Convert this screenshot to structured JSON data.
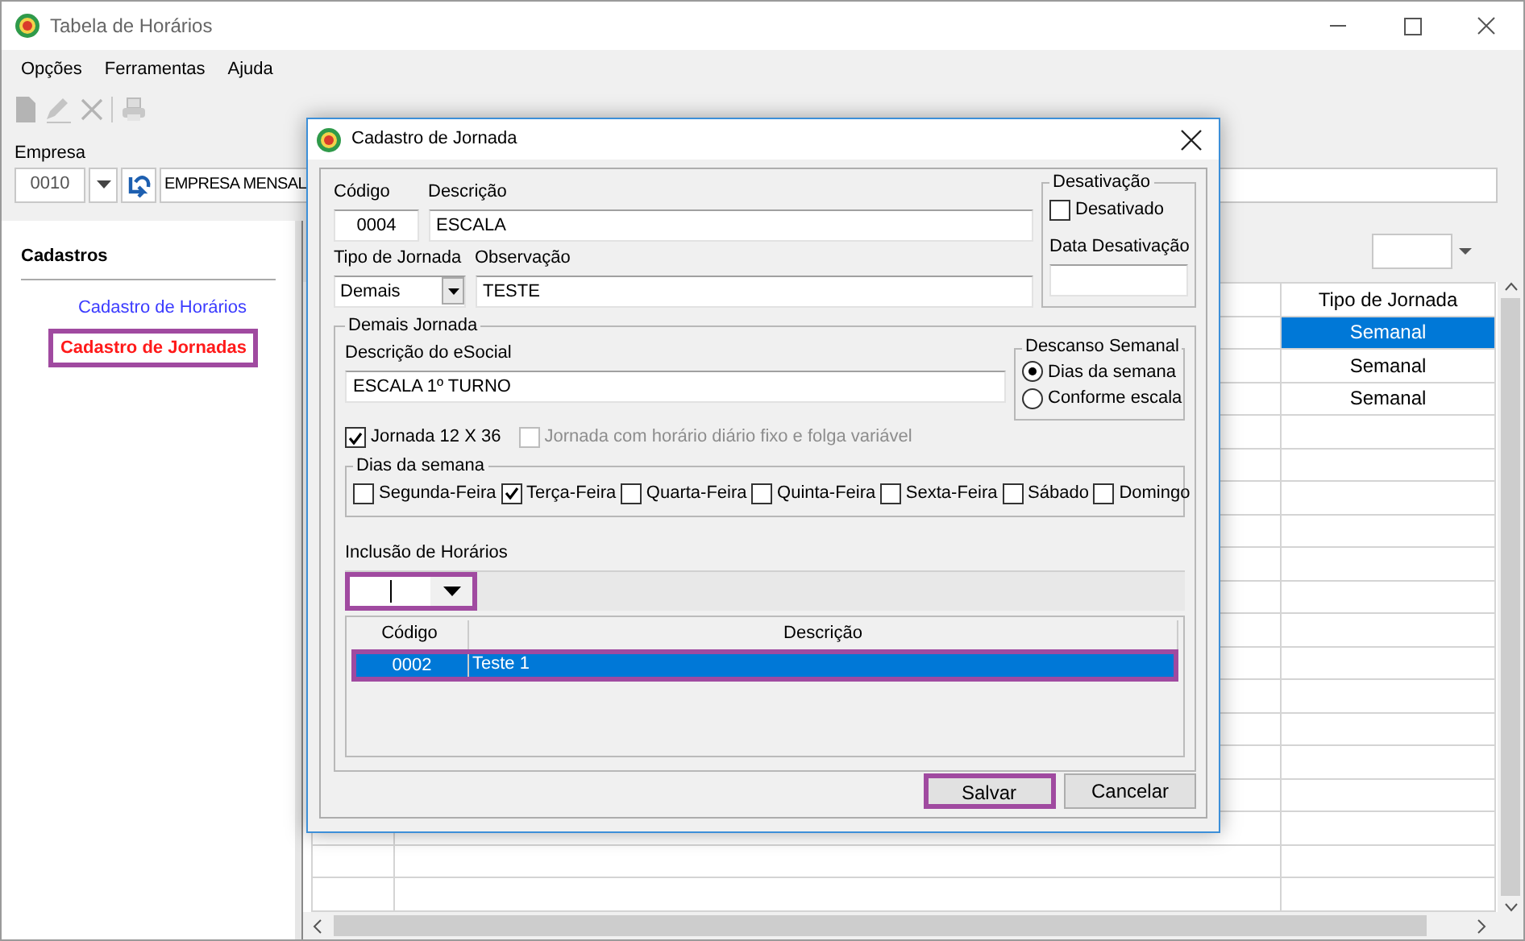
{
  "window": {
    "title": "Tabela de Horários"
  },
  "menu": [
    {
      "label": "Opções"
    },
    {
      "label": "Ferramentas"
    },
    {
      "label": "Ajuda"
    }
  ],
  "empresa": {
    "label": "Empresa",
    "code": "0010",
    "name": "EMPRESA MENSAL"
  },
  "sidebar": {
    "title": "Cadastros",
    "items": [
      {
        "label": "Cadastro de Horários",
        "selected": false,
        "highlighted": false
      },
      {
        "label": "Cadastro de Jornadas",
        "selected": true,
        "highlighted": true
      }
    ]
  },
  "grid": {
    "columns": [
      "Tipo de Jornada"
    ],
    "rows": [
      {
        "tipo_de_jornada": "Semanal",
        "selected": true
      },
      {
        "tipo_de_jornada": "Semanal",
        "selected": false
      },
      {
        "tipo_de_jornada": "Semanal",
        "selected": false
      }
    ]
  },
  "dialog": {
    "title": "Cadastro de Jornada",
    "codigo": {
      "label": "Código",
      "value": "0004"
    },
    "descricao": {
      "label": "Descrição",
      "value": "ESCALA"
    },
    "tipo_jornada": {
      "label": "Tipo de Jornada",
      "value": "Demais"
    },
    "observacao": {
      "label": "Observação",
      "value": "TESTE"
    },
    "desativacao": {
      "title": "Desativação",
      "desativado": {
        "label": "Desativado",
        "checked": false
      },
      "data_label": "Data Desativação"
    },
    "demais_jornada": {
      "title": "Demais Jornada",
      "esocial": {
        "label": "Descrição do eSocial",
        "value": "ESCALA 1º TURNO"
      },
      "descanso": {
        "title": "Descanso Semanal",
        "options": [
          {
            "label": "Dias da semana",
            "selected": true
          },
          {
            "label": "Conforme escala",
            "selected": false
          }
        ]
      },
      "options": [
        {
          "label": "Jornada 12 X 36",
          "checked": true,
          "disabled": false
        },
        {
          "label": "Jornada com horário diário fixo e folga variável",
          "checked": false,
          "disabled": true
        }
      ],
      "dias": {
        "title": "Dias da semana",
        "items": [
          {
            "label": "Segunda-Feira",
            "checked": false
          },
          {
            "label": "Terça-Feira",
            "checked": true
          },
          {
            "label": "Quarta-Feira",
            "checked": false
          },
          {
            "label": "Quinta-Feira",
            "checked": false
          },
          {
            "label": "Sexta-Feira",
            "checked": false
          },
          {
            "label": "Sábado",
            "checked": false
          },
          {
            "label": "Domingo",
            "checked": false
          }
        ]
      }
    },
    "inclusao": {
      "label": "Inclusão de Horários",
      "highlighted": true
    },
    "horarios": {
      "columns": [
        "Código",
        "Descrição"
      ],
      "rows": [
        {
          "codigo": "0002",
          "descricao": "Teste 1",
          "selected": true,
          "highlighted": true
        }
      ]
    },
    "buttons": [
      {
        "label": "Salvar",
        "highlighted": true
      },
      {
        "label": "Cancelar",
        "highlighted": false
      }
    ]
  }
}
